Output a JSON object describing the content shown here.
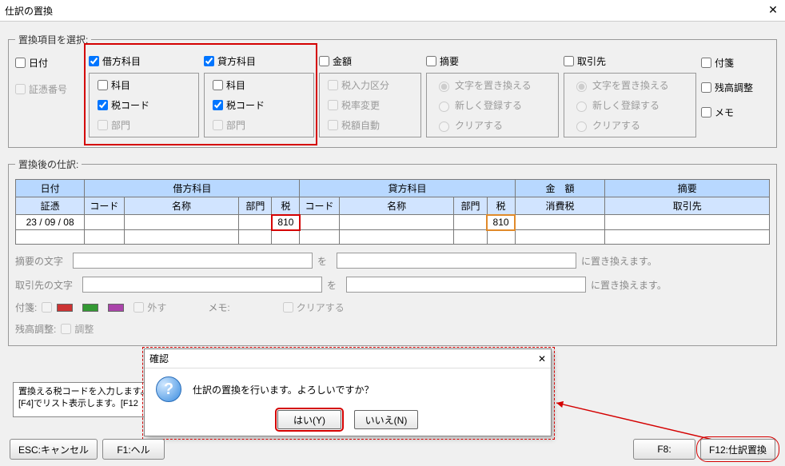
{
  "title": "仕訳の置換",
  "close_x": "✕",
  "group_select_legend": "置換項目を選択:",
  "chk": {
    "date": "日付",
    "voucher": "証憑番号",
    "debit": "借方科目",
    "credit": "貸方科目",
    "amount": "金額",
    "summary": "摘要",
    "partner": "取引先",
    "note": "付箋",
    "balance_adj": "残高調整",
    "memo": "メモ",
    "subject": "科目",
    "taxcode": "税コード",
    "dept": "部門",
    "tax_entry": "税入力区分",
    "tax_rate": "税率変更",
    "tax_auto": "税額自動"
  },
  "radio": {
    "replace_text": "文字を置き換える",
    "register_new": "新しく登録する",
    "clear": "クリアする"
  },
  "group_after_legend": "置換後の仕訳:",
  "table": {
    "h_date": "日付",
    "h_voucher": "証憑",
    "h_debit": "借方科目",
    "h_credit": "貸方科目",
    "h_amount": "金　額",
    "h_summary": "摘要",
    "h_code": "コード",
    "h_name": "名称",
    "h_dept": "部門",
    "h_tax": "税",
    "h_ctax": "消費税",
    "h_partner": "取引先",
    "row_date": "23 / 09 / 08",
    "row_tax_debit": "810",
    "row_tax_credit": "810"
  },
  "labels": {
    "summary_text": "摘要の文字",
    "partner_text": "取引先の文字",
    "wo": "を",
    "ni_replace": "に置き換えます。",
    "fusen": "付箋:",
    "hazusu": "外す",
    "memo2": "メモ:",
    "clear2": "クリアする",
    "balance_adj2": "残高調整:",
    "adjust": "調整"
  },
  "hint": "置換える税コードを入力します。\n[F4]でリスト表示します。[F12",
  "msgbox": {
    "title": "確認",
    "text": "仕訳の置換を行います。よろしいですか？",
    "yes": "はい(Y)",
    "no": "いいえ(N)"
  },
  "footer": {
    "esc": "ESC:キャンセル",
    "f1": "F1:ヘル",
    "f8": "F8:",
    "f12": "F12:仕訳置換"
  }
}
